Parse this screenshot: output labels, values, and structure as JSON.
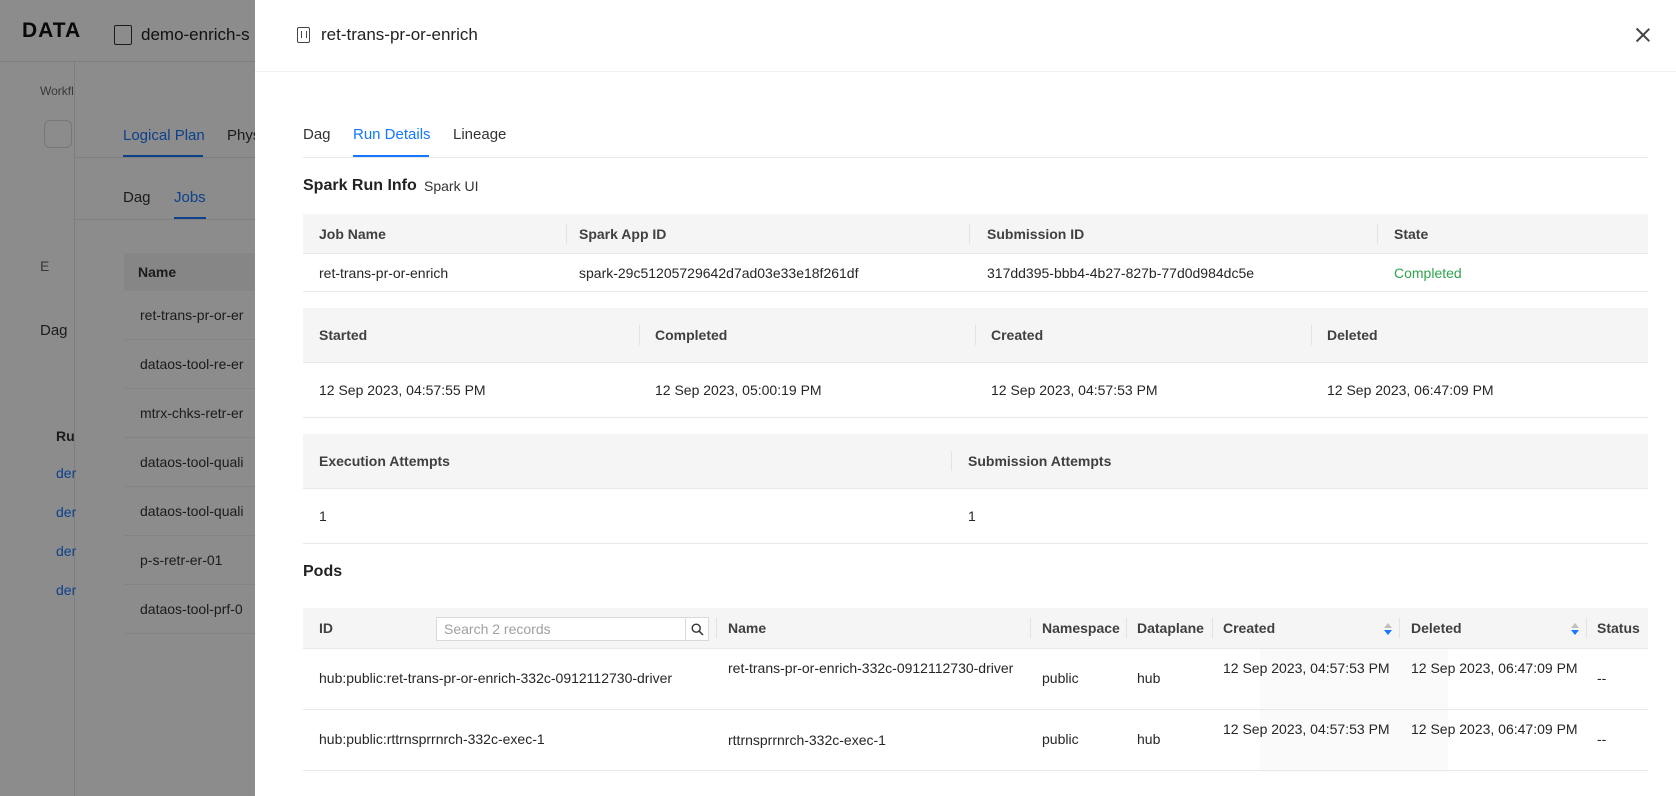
{
  "background": {
    "logo": "DATA",
    "title": "demo-enrich-s",
    "breadcrumb": "Workfl",
    "top_tabs": [
      "Logical Plan",
      "Phys"
    ],
    "sub_tabs": [
      "Dag",
      "Jobs"
    ],
    "nav_e": "E",
    "nav_dag": "Dag",
    "nav_run": "Ru",
    "nav_links": [
      "der",
      "der",
      "der",
      "der"
    ],
    "jobs_header": "Name",
    "jobs": [
      "ret-trans-pr-or-er",
      "dataos-tool-re-er",
      "mtrx-chks-retr-er",
      "dataos-tool-quali",
      "dataos-tool-quali",
      "p-s-retr-er-01",
      "dataos-tool-prf-0"
    ]
  },
  "drawer": {
    "title": "ret-trans-pr-or-enrich",
    "tabs": [
      "Dag",
      "Run Details",
      "Lineage"
    ],
    "active_tab": "Run Details"
  },
  "spark_run_info": {
    "title": "Spark Run Info",
    "spark_ui_label": "Spark UI",
    "table1": {
      "headers": [
        "Job Name",
        "Spark App ID",
        "Submission ID",
        "State"
      ],
      "values": [
        "ret-trans-pr-or-enrich",
        "spark-29c51205729642d7ad03e33e18f261df",
        "317dd395-bbb4-4b27-827b-77d0d984dc5e",
        "Completed"
      ]
    },
    "table2": {
      "headers": [
        "Started",
        "Completed",
        "Created",
        "Deleted"
      ],
      "values": [
        "12 Sep 2023, 04:57:55 PM",
        "12 Sep 2023, 05:00:19 PM",
        "12 Sep 2023, 04:57:53 PM",
        "12 Sep 2023, 06:47:09 PM"
      ]
    },
    "table3": {
      "headers": [
        "Execution Attempts",
        "Submission Attempts"
      ],
      "values": [
        "1",
        "1"
      ]
    }
  },
  "pods": {
    "title": "Pods",
    "search_placeholder": "Search 2 records",
    "headers": [
      "ID",
      "Name",
      "Namespace",
      "Dataplane",
      "Created",
      "Deleted",
      "Status"
    ],
    "rows": [
      {
        "id": "hub:public:ret-trans-pr-or-enrich-332c-0912112730-driver",
        "name": "ret-trans-pr-or-enrich-332c-0912112730-driver",
        "namespace": "public",
        "dataplane": "hub",
        "created": "12 Sep 2023, 04:57:53 PM",
        "deleted": "12 Sep 2023, 06:47:09 PM",
        "status": "--"
      },
      {
        "id": "hub:public:rttrnsprrnrch-332c-exec-1",
        "name": "rttrnsprrnrch-332c-exec-1",
        "namespace": "public",
        "dataplane": "hub",
        "created": "12 Sep 2023, 04:57:53 PM",
        "deleted": "12 Sep 2023, 06:47:09 PM",
        "status": "--"
      }
    ]
  },
  "colors": {
    "accent": "#1677ff",
    "completed": "#2ea44f",
    "overlay": "rgba(0,0,0,0.45)"
  }
}
